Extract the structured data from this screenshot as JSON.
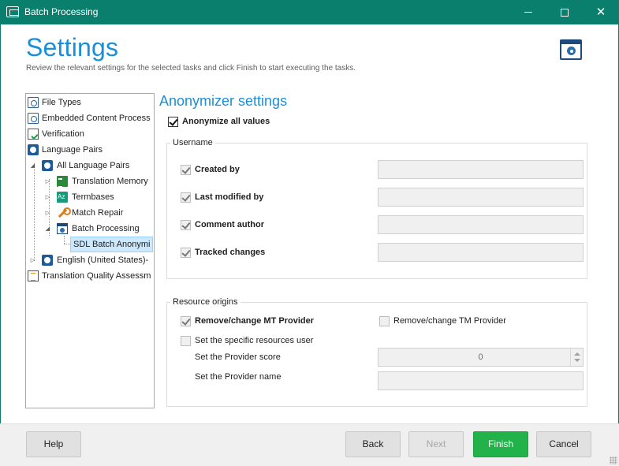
{
  "window": {
    "title": "Batch Processing",
    "minimize_icon": "minimize-icon",
    "maximize_icon": "maximize-icon",
    "close_glyph": "✕"
  },
  "header": {
    "title": "Settings",
    "description": "Review the relevant settings for the selected tasks and click Finish to start executing the tasks.",
    "icon": "batch-settings-icon"
  },
  "tree": {
    "items": [
      {
        "label": "File Types",
        "icon": "file-types-icon"
      },
      {
        "label": "Embedded Content Process",
        "icon": "embedded-content-icon"
      },
      {
        "label": "Verification",
        "icon": "verification-icon"
      },
      {
        "label": "Language Pairs",
        "icon": "language-pairs-icon"
      },
      {
        "label": "All Language Pairs",
        "icon": "language-pairs-icon",
        "expander": "◢"
      },
      {
        "label": "Translation Memory",
        "icon": "translation-memory-icon",
        "expander": "▷"
      },
      {
        "label": "Termbases",
        "icon": "termbase-icon",
        "expander": "▷"
      },
      {
        "label": "Match Repair",
        "icon": "wrench-icon",
        "expander": "▷"
      },
      {
        "label": "Batch Processing",
        "icon": "batch-processing-icon",
        "expander": "◢"
      },
      {
        "label": "SDL Batch Anonymi",
        "icon": "",
        "selected": true
      },
      {
        "label": "English (United States)-",
        "icon": "language-pairs-icon",
        "expander": "▷"
      },
      {
        "label": "Translation Quality Assessm",
        "icon": "quality-assessment-icon"
      }
    ]
  },
  "anonymizer": {
    "title": "Anonymizer settings",
    "anonymize_all_label": "Anonymize all values",
    "anonymize_all_checked": true,
    "username_group": {
      "title": "Username",
      "rows": [
        {
          "label": "Created by",
          "checked": true,
          "value": ""
        },
        {
          "label": "Last modified by",
          "checked": true,
          "value": ""
        },
        {
          "label": "Comment author",
          "checked": true,
          "value": ""
        },
        {
          "label": "Tracked changes",
          "checked": true,
          "value": ""
        }
      ]
    },
    "resource_group": {
      "title": "Resource origins",
      "mt_label": "Remove/change MT Provider",
      "mt_checked": true,
      "tm_label": "Remove/change TM Provider",
      "tm_checked": false,
      "specific_user_label": "Set the specific resources user",
      "specific_user_checked": false,
      "score_label": "Set the Provider score",
      "score_value": "0",
      "name_label": "Set the Provider name",
      "name_value": ""
    }
  },
  "buttons": {
    "help": "Help",
    "back": "Back",
    "next": "Next",
    "finish": "Finish",
    "cancel": "Cancel"
  },
  "colors": {
    "titlebar": "#0b7f6e",
    "accent_blue": "#1a8fd8",
    "finish_green": "#21b24a"
  }
}
